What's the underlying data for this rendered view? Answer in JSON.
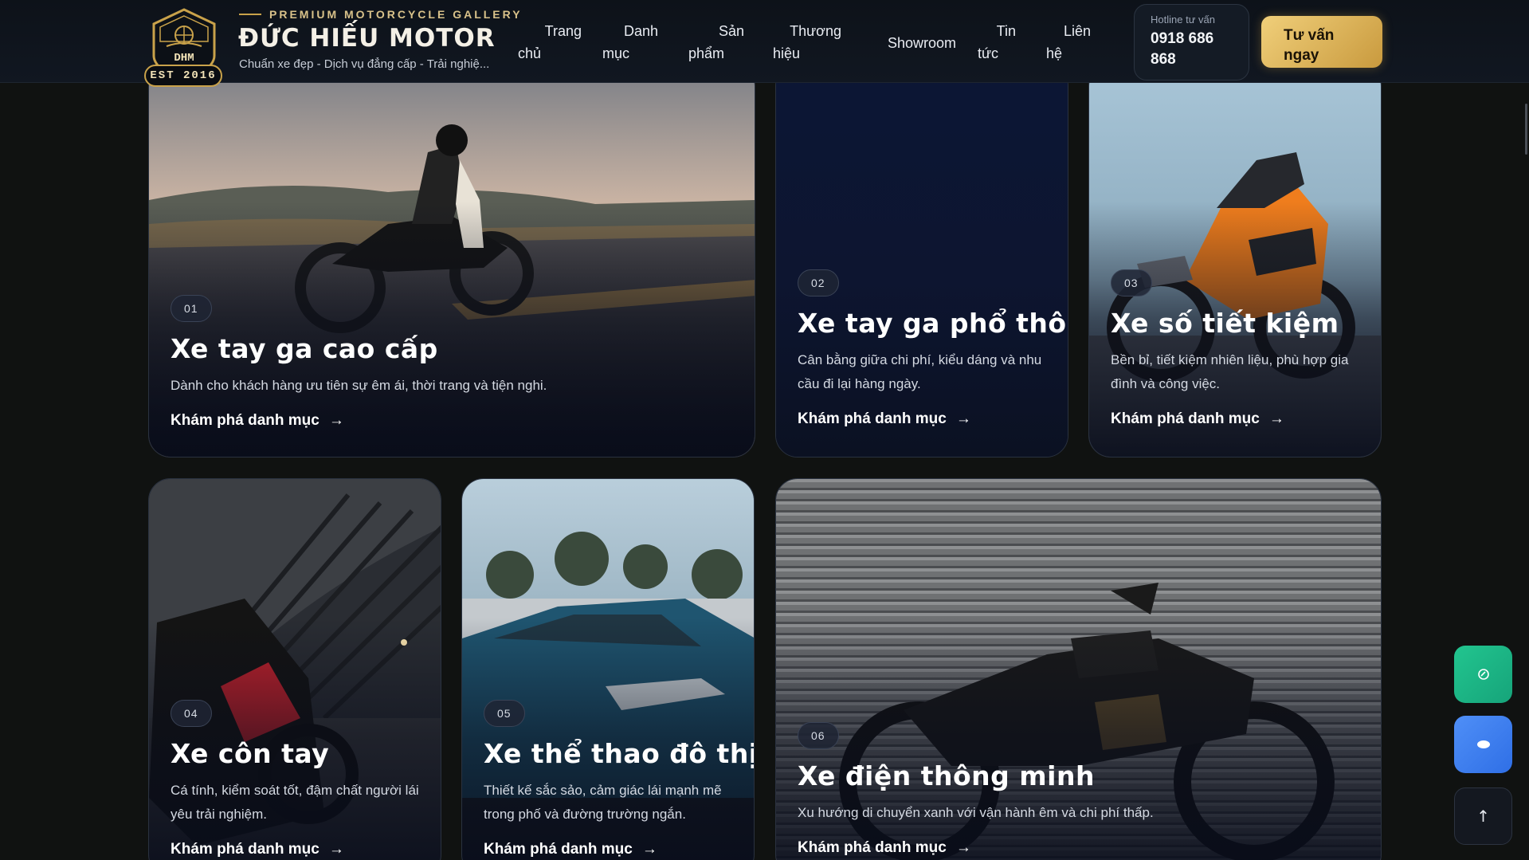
{
  "header": {
    "logo_text": "DHM",
    "est": "EST 2016",
    "tagline": "PREMIUM MOTORCYCLE GALLERY",
    "brand_name": "ĐỨC HIẾU MOTOR",
    "subtitle": "Chuẩn xe đẹp - Dịch vụ đẳng cấp - Trải nghiệ...",
    "nav": [
      {
        "line1": "Trang",
        "line2": "chủ"
      },
      {
        "line1": "Danh",
        "line2": "mục"
      },
      {
        "line1": "Sản",
        "line2": "phẩm"
      },
      {
        "line1": "Thương",
        "line2": "hiệu"
      },
      {
        "line1": "Showroom",
        "line2": ""
      },
      {
        "line1": "Tin",
        "line2": "tức"
      },
      {
        "line1": "Liên",
        "line2": "hệ"
      }
    ],
    "hotline_label": "Hotline tư vấn",
    "hotline_number": "0918 686 868",
    "cta_label": "Tư vấn ngay"
  },
  "categories": [
    {
      "index": "01",
      "title": "Xe tay ga cao cấp",
      "desc": "Dành cho khách hàng ưu tiên sự êm ái, thời trang và tiện nghi.",
      "link": "Khám phá danh mục",
      "arrow": "→"
    },
    {
      "index": "02",
      "title": "Xe tay ga phổ thông",
      "desc": "Cân bằng giữa chi phí, kiểu dáng và nhu cầu đi lại hàng ngày.",
      "link": "Khám phá danh mục",
      "arrow": "→"
    },
    {
      "index": "03",
      "title": "Xe số tiết kiệm",
      "desc": "Bền bỉ, tiết kiệm nhiên liệu, phù hợp gia đình và công việc.",
      "link": "Khám phá danh mục",
      "arrow": "→"
    },
    {
      "index": "04",
      "title": "Xe côn tay",
      "desc": "Cá tính, kiểm soát tốt, đậm chất người lái yêu trải nghiệm.",
      "link": "Khám phá danh mục",
      "arrow": "→"
    },
    {
      "index": "05",
      "title": "Xe thể thao đô thị",
      "desc": "Thiết kế sắc sảo, cảm giác lái mạnh mẽ trong phố và đường trường ngắn.",
      "link": "Khám phá danh mục",
      "arrow": "→"
    },
    {
      "index": "06",
      "title": "Xe điện thông minh",
      "desc": "Xu hướng di chuyển xanh với vận hành êm và chi phí thấp.",
      "link": "Khám phá danh mục",
      "arrow": "→"
    }
  ],
  "floating": {
    "scroll_top_arrow": "↑",
    "colors": {
      "zalo": "#1fba8d",
      "messenger": "#3b82f6",
      "top": "#141820"
    }
  },
  "colors": {
    "accent_gold": "#c9a24a",
    "bg": "#101211",
    "header": "#0f141c"
  }
}
